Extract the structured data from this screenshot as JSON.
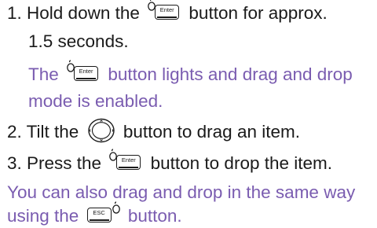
{
  "instructions": {
    "step1": {
      "number": "1.",
      "pre": "Hold down the",
      "post": "button for approx.",
      "cont": "1.5 seconds.",
      "key_label": "Enter",
      "key_icon": "enter-key-icon"
    },
    "step1_note": {
      "pre": "The",
      "post": "button lights and drag and drop",
      "cont": "mode is enabled.",
      "key_label": "Enter",
      "key_icon": "enter-key-icon"
    },
    "step2": {
      "number": "2.",
      "pre": "Tilt the",
      "post": "button to drag an item.",
      "button_icon": "joystick-button-icon"
    },
    "step3": {
      "number": "3.",
      "pre": "Press the",
      "post": "button to drop the item.",
      "key_label": "Enter",
      "key_icon": "enter-key-icon"
    },
    "note": {
      "line1": "You can also drag and drop in the same way",
      "pre": "using the",
      "post": "button.",
      "key_label": "ESC",
      "key_icon": "esc-key-icon"
    }
  },
  "colors": {
    "text": "#1a1a1a",
    "note_text": "#7a5cb0"
  }
}
